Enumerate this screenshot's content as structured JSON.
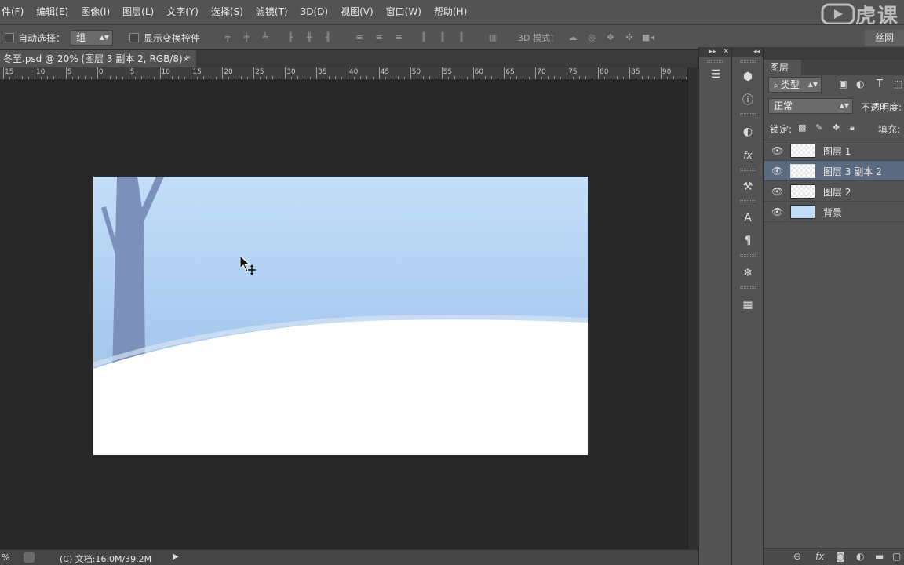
{
  "menu": [
    "件(F)",
    "编辑(E)",
    "图像(I)",
    "图层(L)",
    "文字(Y)",
    "选择(S)",
    "滤镜(T)",
    "3D(D)",
    "视图(V)",
    "窗口(W)",
    "帮助(H)"
  ],
  "watermark": {
    "brand": "虎课",
    "button": "丝网"
  },
  "options": {
    "auto_select_label": "自动选择：",
    "auto_select_value": "组",
    "show_transform_label": "显示变换控件",
    "mode_3d_label": "3D 模式："
  },
  "document_tab": {
    "title": "冬至.psd @ 20% (图层 3 副本 2, RGB/8) *",
    "close": "×"
  },
  "ruler_labels": [
    "15",
    "10",
    "5",
    "0",
    "5",
    "10",
    "15",
    "20",
    "25",
    "30",
    "35",
    "40",
    "45",
    "50",
    "55",
    "60",
    "65",
    "70",
    "75",
    "80",
    "85",
    "90",
    "9"
  ],
  "status": {
    "zoom": "%",
    "doc_info": "(C) 文档:16.0M/39.2M",
    "arrow": "▶"
  },
  "panel_header": {
    "collapse": "▸▸",
    "close": "✕"
  },
  "layers_panel": {
    "tab_label": "图层",
    "filter_label": "类型",
    "blend_mode": "正常",
    "opacity_label": "不透明度:",
    "lock_label": "锁定:",
    "fill_label": "填充:",
    "layers": [
      {
        "name": "图层 1",
        "selected": false
      },
      {
        "name": "图层 3 副本 2",
        "selected": true
      },
      {
        "name": "图层 2",
        "selected": false
      },
      {
        "name": "背景",
        "selected": false
      }
    ]
  },
  "colors": {
    "app_bg": "#282828",
    "panel": "#535353",
    "sky": "#b9d7f5",
    "snow": "#ffffff",
    "tree": "#7b91ba",
    "selected_layer": "#5b6a80"
  }
}
